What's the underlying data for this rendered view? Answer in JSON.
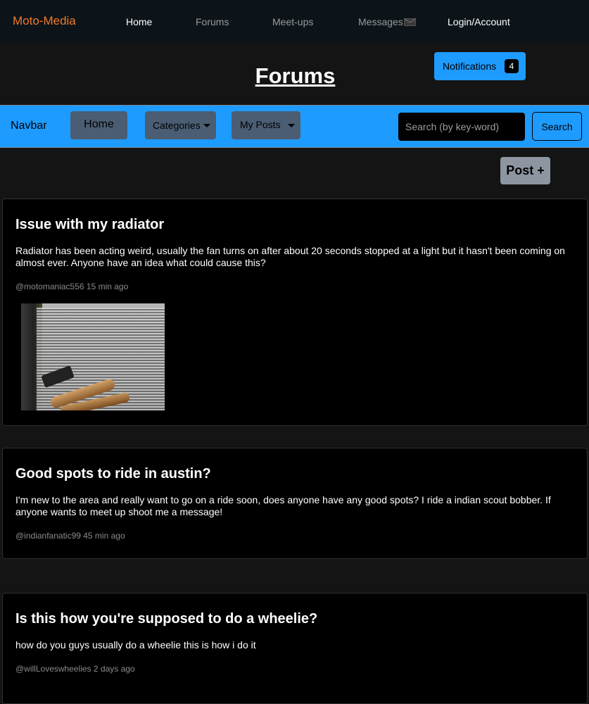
{
  "topnav": {
    "brand": "Moto-Media",
    "links": [
      {
        "label": "Home"
      },
      {
        "label": "Forums"
      },
      {
        "label": "Meet-ups"
      },
      {
        "label": "Messages"
      },
      {
        "label": "Login/Account"
      }
    ]
  },
  "header": {
    "title": "Forums",
    "notifications_label": "Notifications",
    "notifications_count": "4"
  },
  "navbar": {
    "brand": "Navbar",
    "home_label": "Home",
    "categories_label": "Categories",
    "my_posts_label": "My Posts",
    "search_placeholder": "Search (by key-word)",
    "search_button": "Search"
  },
  "post_button": "Post +",
  "posts": [
    {
      "title": "Issue with my radiator",
      "body": "Radiator has been acting weird, usually the fan turns on after about 20 seconds stopped at a light but it hasn't been coming on almost ever. Anyone have an idea what could cause this?",
      "meta": "@motomaniac556 15 min ago"
    },
    {
      "title": "Good spots to ride in austin?",
      "body": "I'm new to the area and really want to go on a ride soon, does anyone have any good spots? I ride a indian scout bobber. If anyone wants to meet up shoot me a message!",
      "meta": "@indianfanatic99 45 min ago"
    },
    {
      "title": "Is this how you're supposed to do a wheelie?",
      "body": "how do you guys usually do a wheelie this is how i do it",
      "meta": "@willLoveswheelies 2 days ago"
    }
  ]
}
